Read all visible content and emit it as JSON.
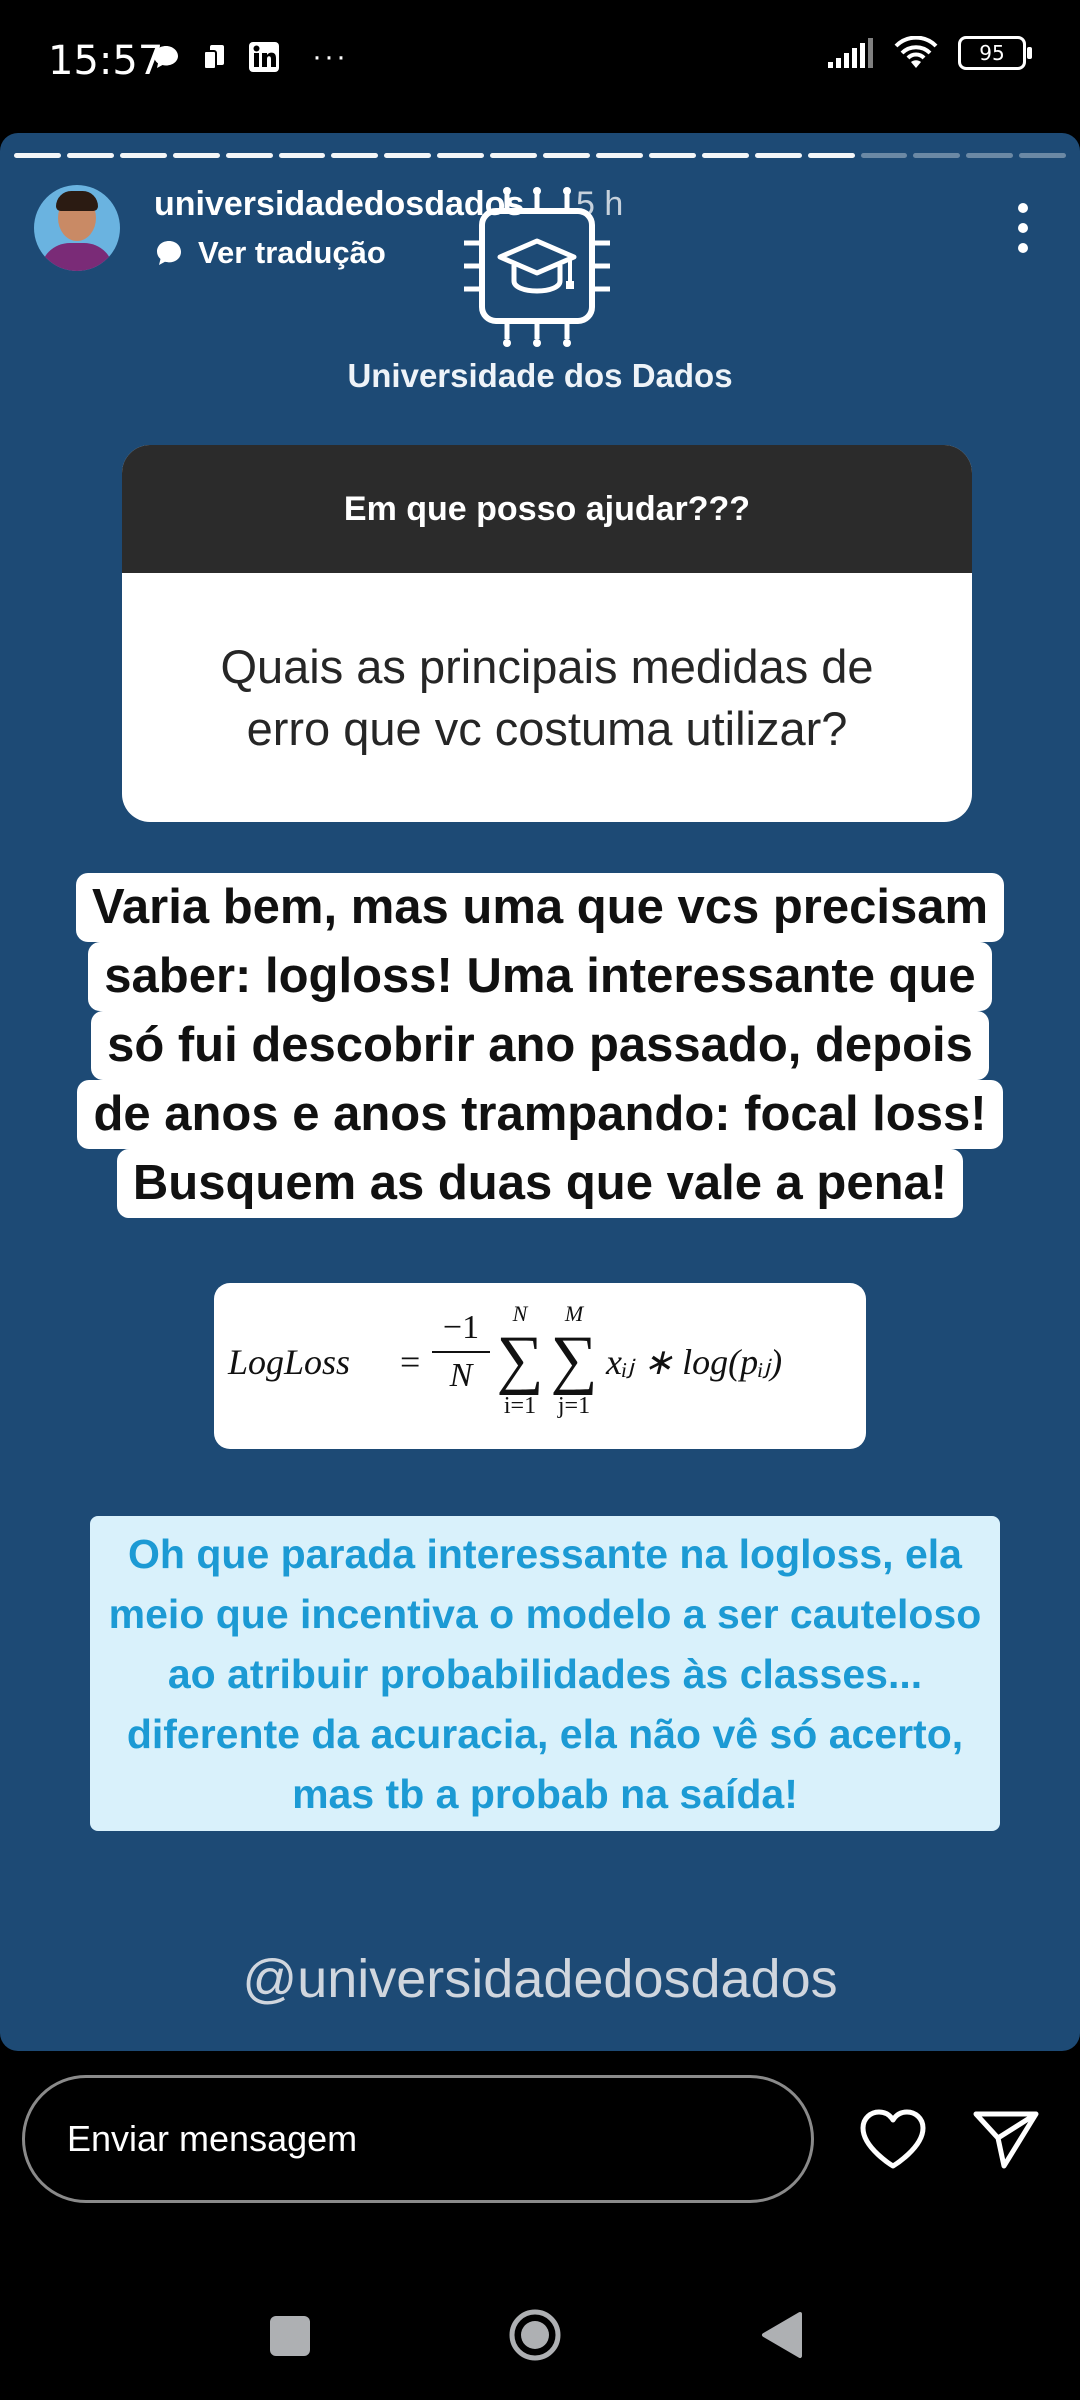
{
  "status_bar": {
    "time": "15:57",
    "battery": "95",
    "more": "···"
  },
  "story": {
    "username": "universidadedosdados",
    "time_ago": "5 h",
    "translate_label": "Ver tradução",
    "progress_segments_total": 20,
    "progress_segments_viewed": 16,
    "logo_text": "Universidade dos Dados",
    "question_prompt": "Em que posso ajudar???",
    "question_text": "Quais as principais medidas de erro que vc costuma utilizar?",
    "answer_lines": [
      "Varia bem, mas uma que vcs precisam",
      "saber: logloss! Uma interessante que",
      "só fui descobrir ano passado, depois",
      "de anos e anos trampando: focal loss!",
      "Busquem as duas que vale a pena!"
    ],
    "formula": {
      "lhs": "LogLoss",
      "eq": "=",
      "numerator": "−1",
      "denominator": "N",
      "sum1_upper": "N",
      "sum1_lower": "i=1",
      "sum2_upper": "M",
      "sum2_lower": "j=1",
      "sigma": "∑",
      "rhs": "xᵢⱼ ∗  log(pᵢⱼ)"
    },
    "note_text": "Oh que parada interessante na logloss, ela meio que incentiva o modelo a ser cauteloso ao atribuir probabilidades às classes... diferente da acuracia, ela não vê só acerto, mas tb a probab na saída!",
    "handle": "@universidadedosdados"
  },
  "bottom": {
    "message_placeholder": "Enviar mensagem"
  },
  "colors": {
    "story_bg": "#1d4a75",
    "note_bg": "#d9f1fb",
    "note_text": "#1c9ad4",
    "question_header_bg": "#2b2b2b"
  }
}
